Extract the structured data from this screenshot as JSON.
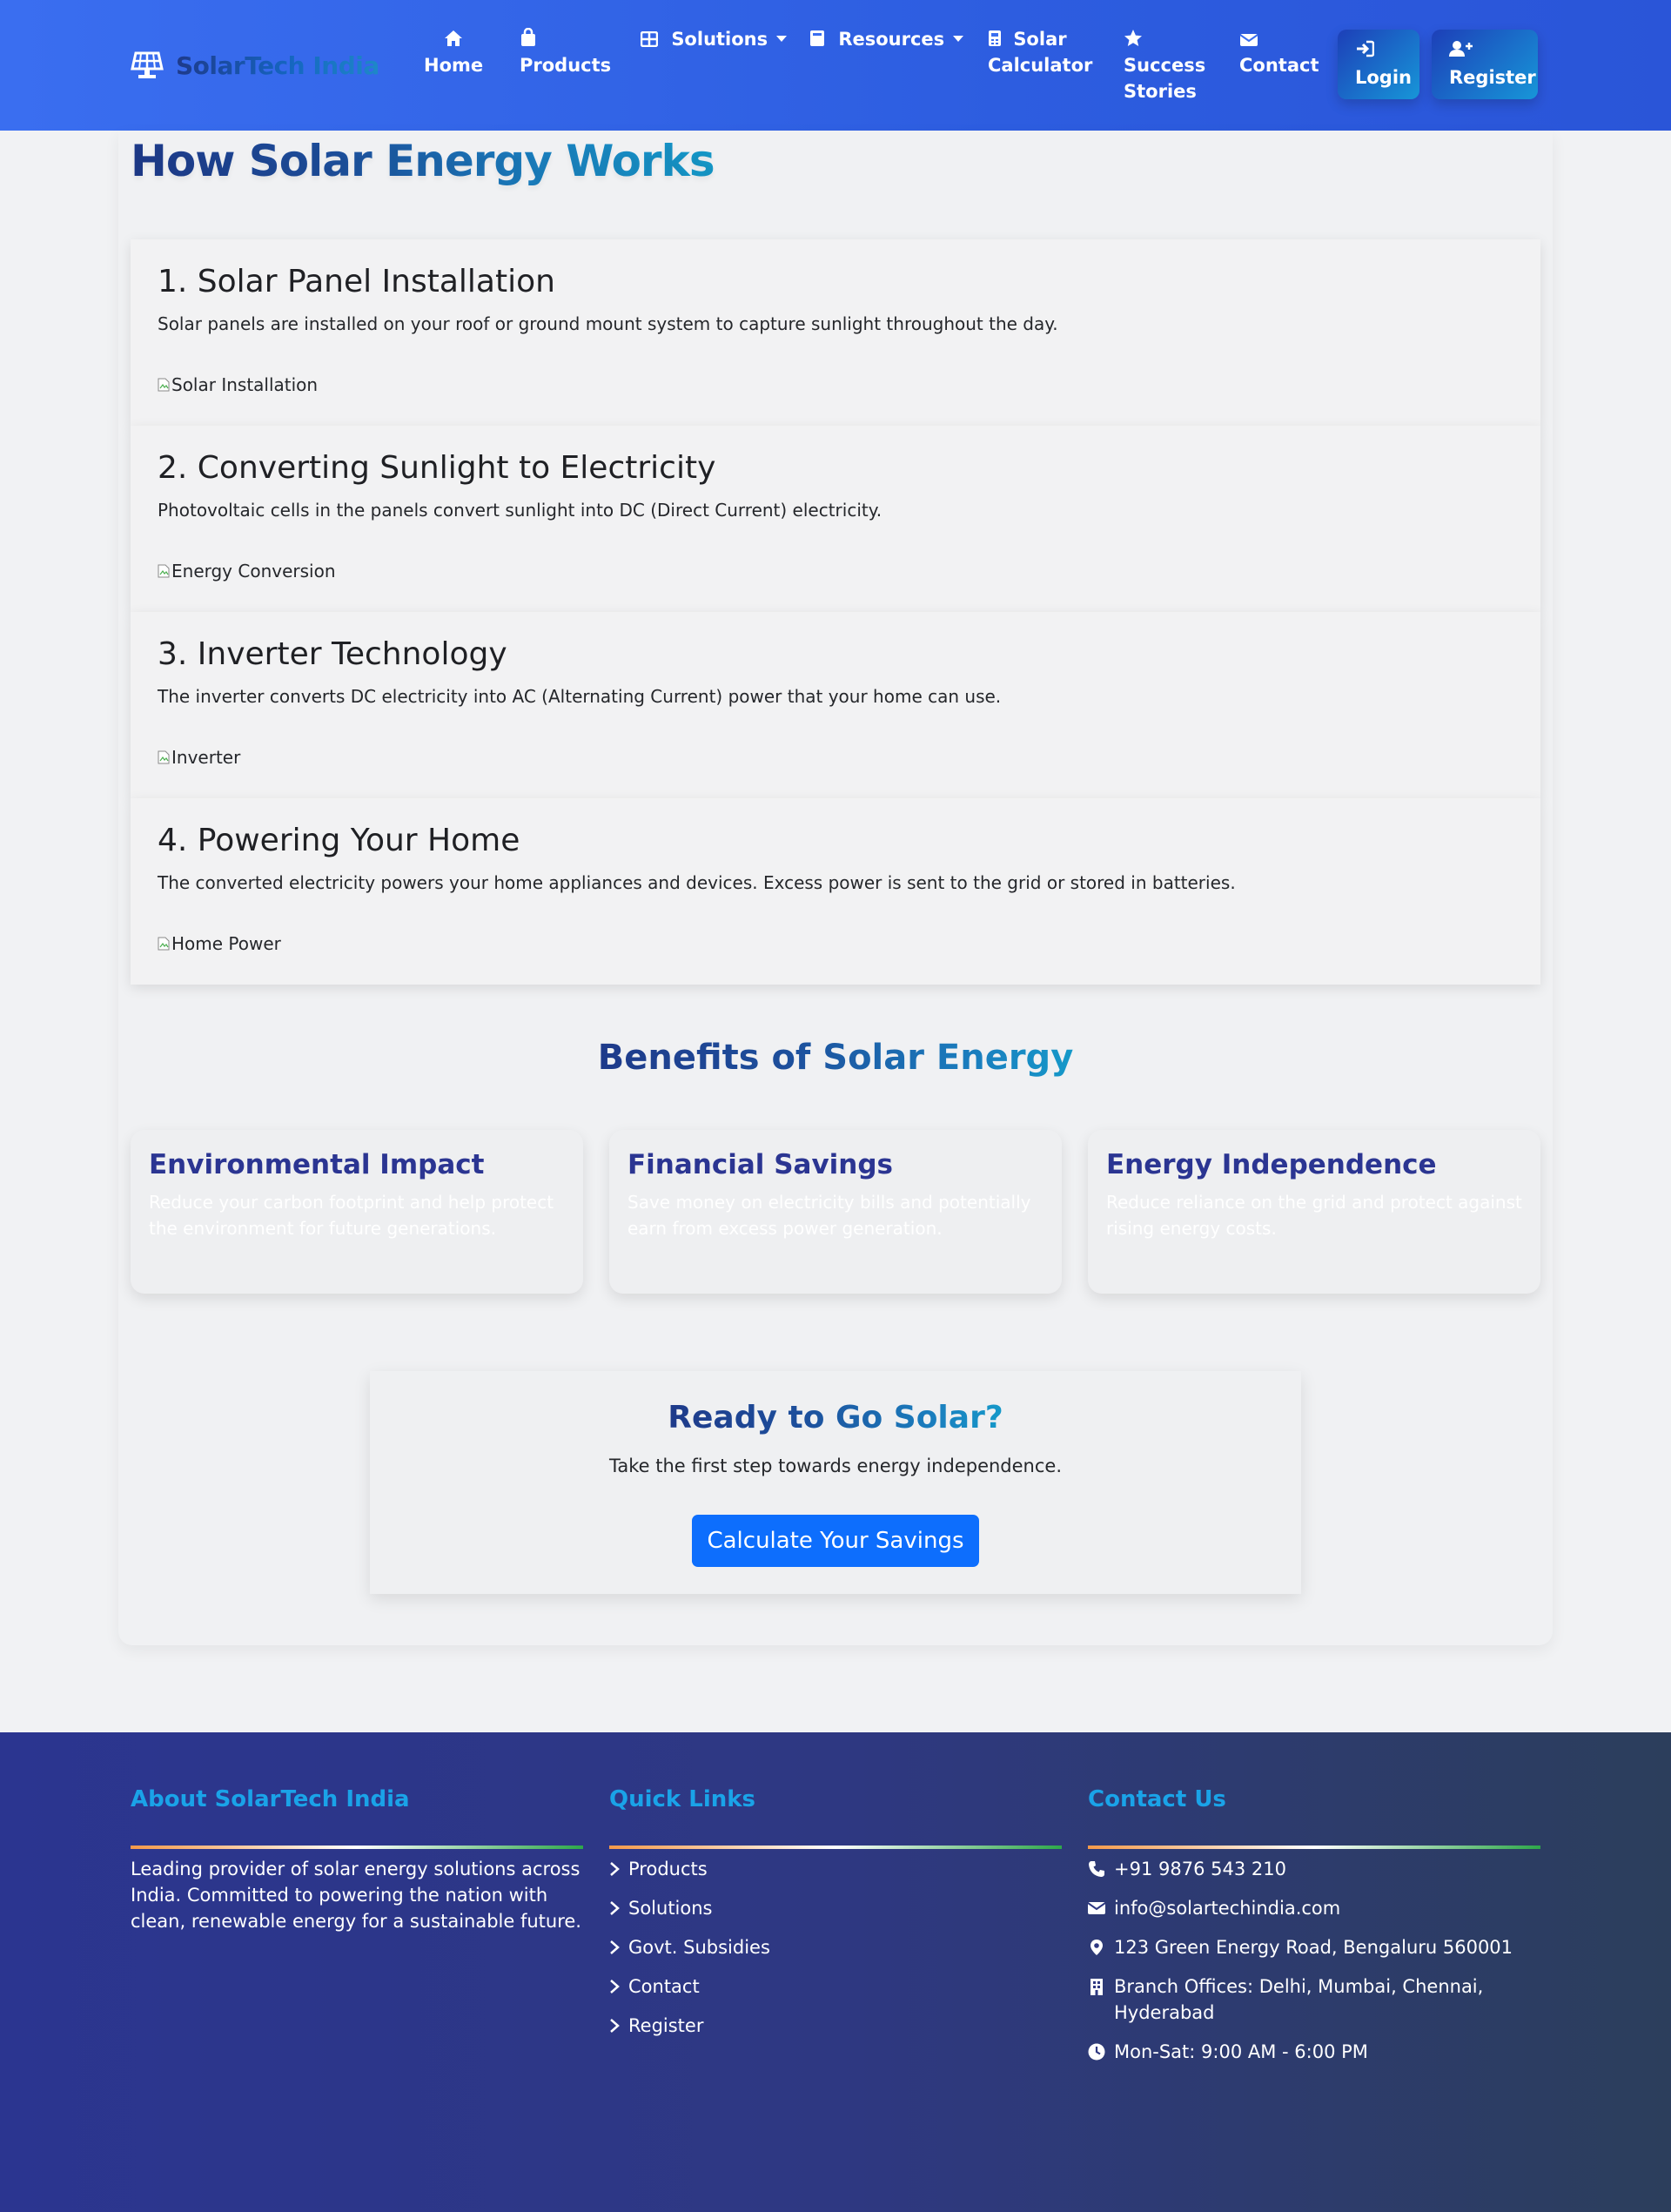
{
  "nav": {
    "brand": "SolarTech India",
    "items": [
      {
        "label": "Home",
        "icon": "home-icon"
      },
      {
        "label": "Products",
        "icon": "bag-icon"
      },
      {
        "label": "Solutions",
        "icon": "grid-icon",
        "dropdown": true
      },
      {
        "label": "Resources",
        "icon": "book-icon",
        "dropdown": true
      },
      {
        "label_line1": "Solar",
        "label_line2": "Calculator",
        "icon": "calculator-icon"
      },
      {
        "label_line1": "Success",
        "label_line2": "Stories",
        "icon": "star-icon"
      },
      {
        "label": "Contact",
        "icon": "envelope-icon"
      }
    ],
    "login": "Login",
    "register": "Register"
  },
  "main": {
    "title": "How Solar Energy Works",
    "steps": [
      {
        "title": "1. Solar Panel Installation",
        "text": "Solar panels are installed on your roof or ground mount system to capture sunlight throughout the day.",
        "img_alt": "Solar Installation"
      },
      {
        "title": "2. Converting Sunlight to Electricity",
        "text": "Photovoltaic cells in the panels convert sunlight into DC (Direct Current) electricity.",
        "img_alt": "Energy Conversion"
      },
      {
        "title": "3. Inverter Technology",
        "text": "The inverter converts DC electricity into AC (Alternating Current) power that your home can use.",
        "img_alt": "Inverter"
      },
      {
        "title": "4. Powering Your Home",
        "text": "The converted electricity powers your home appliances and devices. Excess power is sent to the grid or stored in batteries.",
        "img_alt": "Home Power"
      }
    ],
    "benefits_title": "Benefits of Solar Energy",
    "benefits": [
      {
        "title": "Environmental Impact",
        "text": "Reduce your carbon footprint and help protect the environment for future generations."
      },
      {
        "title": "Financial Savings",
        "text": "Save money on electricity bills and potentially earn from excess power generation."
      },
      {
        "title": "Energy Independence",
        "text": "Reduce reliance on the grid and protect against rising energy costs."
      }
    ],
    "cta": {
      "title": "Ready to Go Solar?",
      "text": "Take the first step towards energy independence.",
      "button": "Calculate Your Savings"
    }
  },
  "footer": {
    "about_title": "About SolarTech India",
    "about_text": "Leading provider of solar energy solutions across India. Committed to powering the nation with clean, renewable energy for a sustainable future.",
    "links_title": "Quick Links",
    "links": [
      "Products",
      "Solutions",
      "Govt. Subsidies",
      "Contact",
      "Register"
    ],
    "contact_title": "Contact Us",
    "contact": {
      "phone": "+91 9876 543 210",
      "email": "info@solartechindia.com",
      "address": "123 Green Energy Road, Bengaluru 560001",
      "branches": "Branch Offices: Delhi, Mumbai, Chennai, Hyderabad",
      "hours": "Mon-Sat: 9:00 AM - 6:00 PM"
    }
  },
  "colors": {
    "navbar": "#3a6ef0",
    "accent_blue": "#0d6efd",
    "footer_heading": "#1aa3e8",
    "benefit_heading": "#2b3592"
  }
}
